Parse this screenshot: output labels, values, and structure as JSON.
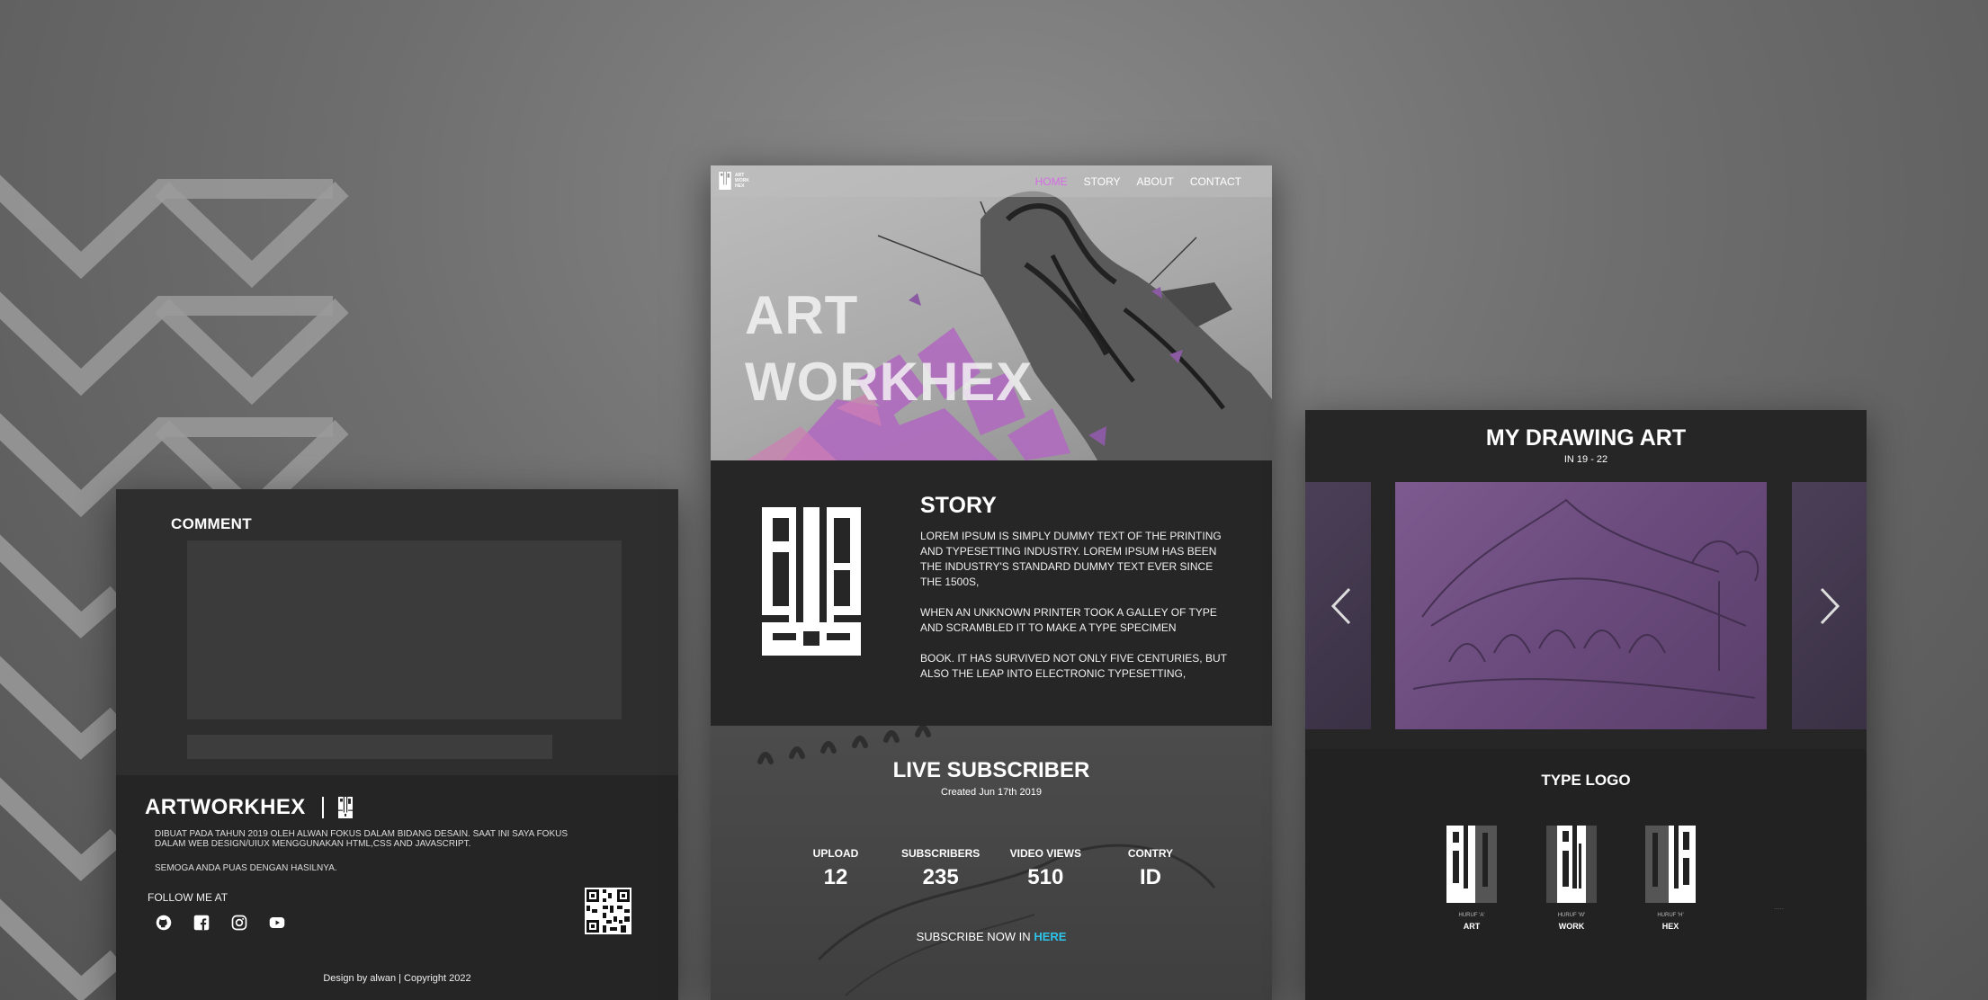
{
  "colors": {
    "accent_pink": "#d46de3",
    "link_cyan": "#2ec4ea",
    "panel_dark": "#262626"
  },
  "comment_section": {
    "title": "COMMENT"
  },
  "footer": {
    "brand": "ARTWORKHEX",
    "description": "DIBUAT PADA TAHUN 2019 OLEH ALWAN FOKUS DALAM BIDANG DESAIN. SAAT INI SAYA FOKUS DALAM WEB DESIGN/UIUX  MENGGUNAKAN HTML,CSS AND JAVASCRIPT.",
    "note": "SEMOGA  ANDA PUAS DENGAN HASILNYA.",
    "follow_label": "FOLLOW ME AT",
    "socials": [
      "github-icon",
      "facebook-icon",
      "instagram-icon",
      "youtube-icon"
    ],
    "copyright": "Design by alwan  |  Copyright 2022"
  },
  "nav": {
    "logo_text": [
      "ART",
      "WORK",
      "HEX"
    ],
    "links": [
      "HOME",
      "STORY",
      "ABOUT",
      "CONTACT"
    ],
    "active": "HOME"
  },
  "hero": {
    "title_line1": "ART",
    "title_line2": "WORKHEX"
  },
  "story": {
    "title": "STORY",
    "paragraphs": [
      "LOREM IPSUM IS SIMPLY DUMMY TEXT OF THE PRINTING AND TYPESETTING INDUSTRY. LOREM IPSUM HAS BEEN THE INDUSTRY'S STANDARD DUMMY TEXT EVER SINCE THE 1500S,",
      "WHEN AN UNKNOWN PRINTER TOOK A GALLEY OF TYPE AND SCRAMBLED IT TO MAKE A TYPE SPECIMEN",
      "BOOK. IT HAS SURVIVED NOT ONLY FIVE CENTURIES, BUT ALSO THE LEAP INTO ELECTRONIC TYPESETTING,"
    ]
  },
  "live": {
    "title": "LIVE SUBSCRIBER",
    "created": "Created Jun 17th 2019",
    "stats": [
      {
        "label": "UPLOAD",
        "value": "12"
      },
      {
        "label": "SUBSCRIBERS",
        "value": "235"
      },
      {
        "label": "VIDEO VIEWS",
        "value": "510"
      },
      {
        "label": "CONTRY",
        "value": "ID"
      }
    ],
    "subscribe_text": "SUBSCRIBE NOW IN",
    "subscribe_link": "HERE"
  },
  "gallery": {
    "title": "MY DRAWING ART",
    "subtitle": "IN 19 - 22"
  },
  "type_logo": {
    "title": "TYPE LOGO",
    "items": [
      {
        "caption": "HURUF 'A'",
        "name": "ART"
      },
      {
        "caption": "HURUF 'W'",
        "name": "WORK"
      },
      {
        "caption": "HURUF 'H'",
        "name": "HEX"
      }
    ],
    "more": "....."
  }
}
